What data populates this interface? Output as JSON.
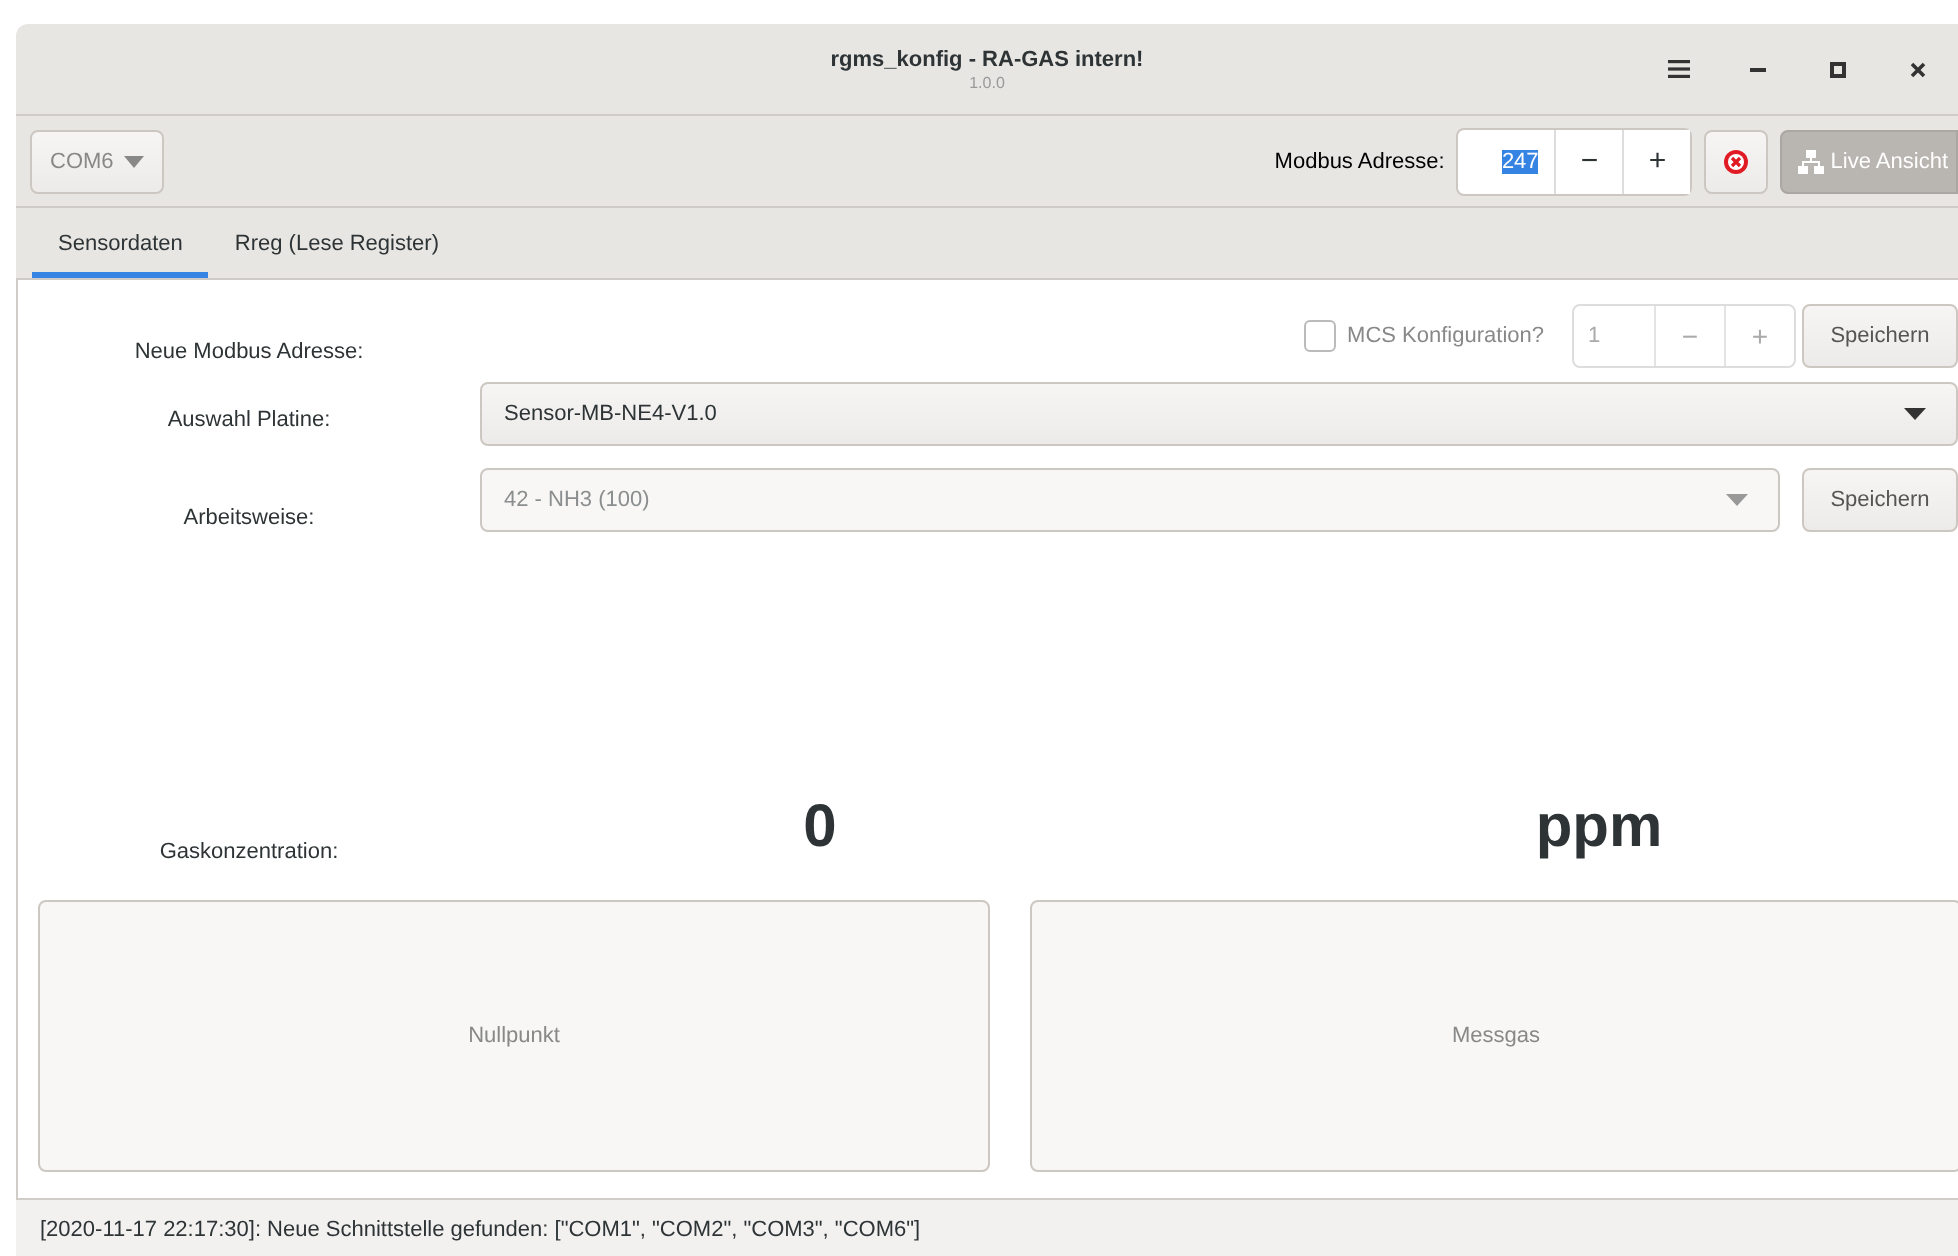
{
  "window": {
    "title": "rgms_konfig - RA-GAS intern!",
    "version": "1.0.0"
  },
  "toolbar": {
    "port": "COM6",
    "modbus_label": "Modbus Adresse:",
    "modbus_address": {
      "value": "247",
      "text_selected": true,
      "step_buttons": [
        "−",
        "+"
      ]
    },
    "live_button": {
      "label": "Live Ansicht",
      "disabled": true
    }
  },
  "tabs": [
    {
      "label": "Sensordaten",
      "selected": true
    },
    {
      "label": "Rreg (Lese Register)",
      "selected": false
    }
  ],
  "form": {
    "new_address_label": "Neue Modbus Adresse:",
    "mcs": {
      "label": "MCS Konfiguration?",
      "checked": false
    },
    "mcs_spin": {
      "value": "1",
      "disabled": true,
      "step_buttons": [
        "−",
        "+"
      ]
    },
    "save_1": "Speichern",
    "board_label": "Auswahl Platine:",
    "board": {
      "value": "Sensor-MB-NE4-V1.0",
      "disabled": false
    },
    "mode_label": "Arbeitsweise:",
    "mode": {
      "value": "42 - NH3 (100)",
      "disabled": true
    },
    "save_2": "Speichern",
    "gas_label": "Gaskonzentration:",
    "gas_value": "0",
    "gas_unit": "ppm"
  },
  "actions": [
    {
      "label": "Nullpunkt"
    },
    {
      "label": "Messgas"
    }
  ],
  "status_bar": "[2020-11-17 22:17:30]: Neue Schnittstelle gefunden: [\"COM1\", \"COM2\", \"COM3\", \"COM6\"]"
}
